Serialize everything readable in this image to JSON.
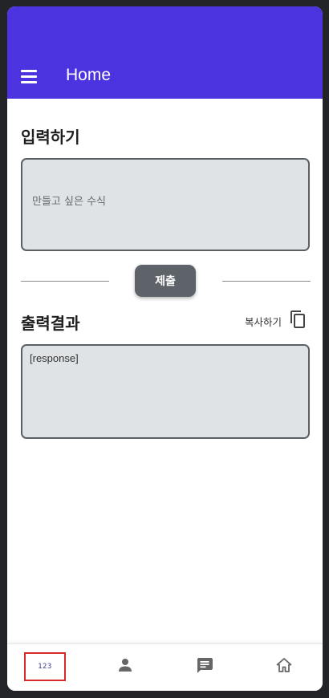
{
  "app_bar": {
    "title": "Home",
    "color": "#4b34e0",
    "menu_icon": "hamburger-menu-icon"
  },
  "input_section": {
    "title": "입력하기",
    "placeholder": "만들고 싶은 수식",
    "value": ""
  },
  "submit": {
    "label": "제출"
  },
  "output_section": {
    "title": "출력결과",
    "copy_label": "복사하기",
    "copy_icon": "copy-icon",
    "response": "[response]"
  },
  "bottom_nav": {
    "items": [
      {
        "name": "numbers",
        "label": "123",
        "icon": "numbers-123-icon",
        "active": true
      },
      {
        "name": "profile",
        "icon": "person-icon",
        "active": false
      },
      {
        "name": "messages",
        "icon": "message-icon",
        "active": false
      },
      {
        "name": "home",
        "icon": "home-icon",
        "active": false
      }
    ],
    "active_border_color": "#d42a2a"
  }
}
